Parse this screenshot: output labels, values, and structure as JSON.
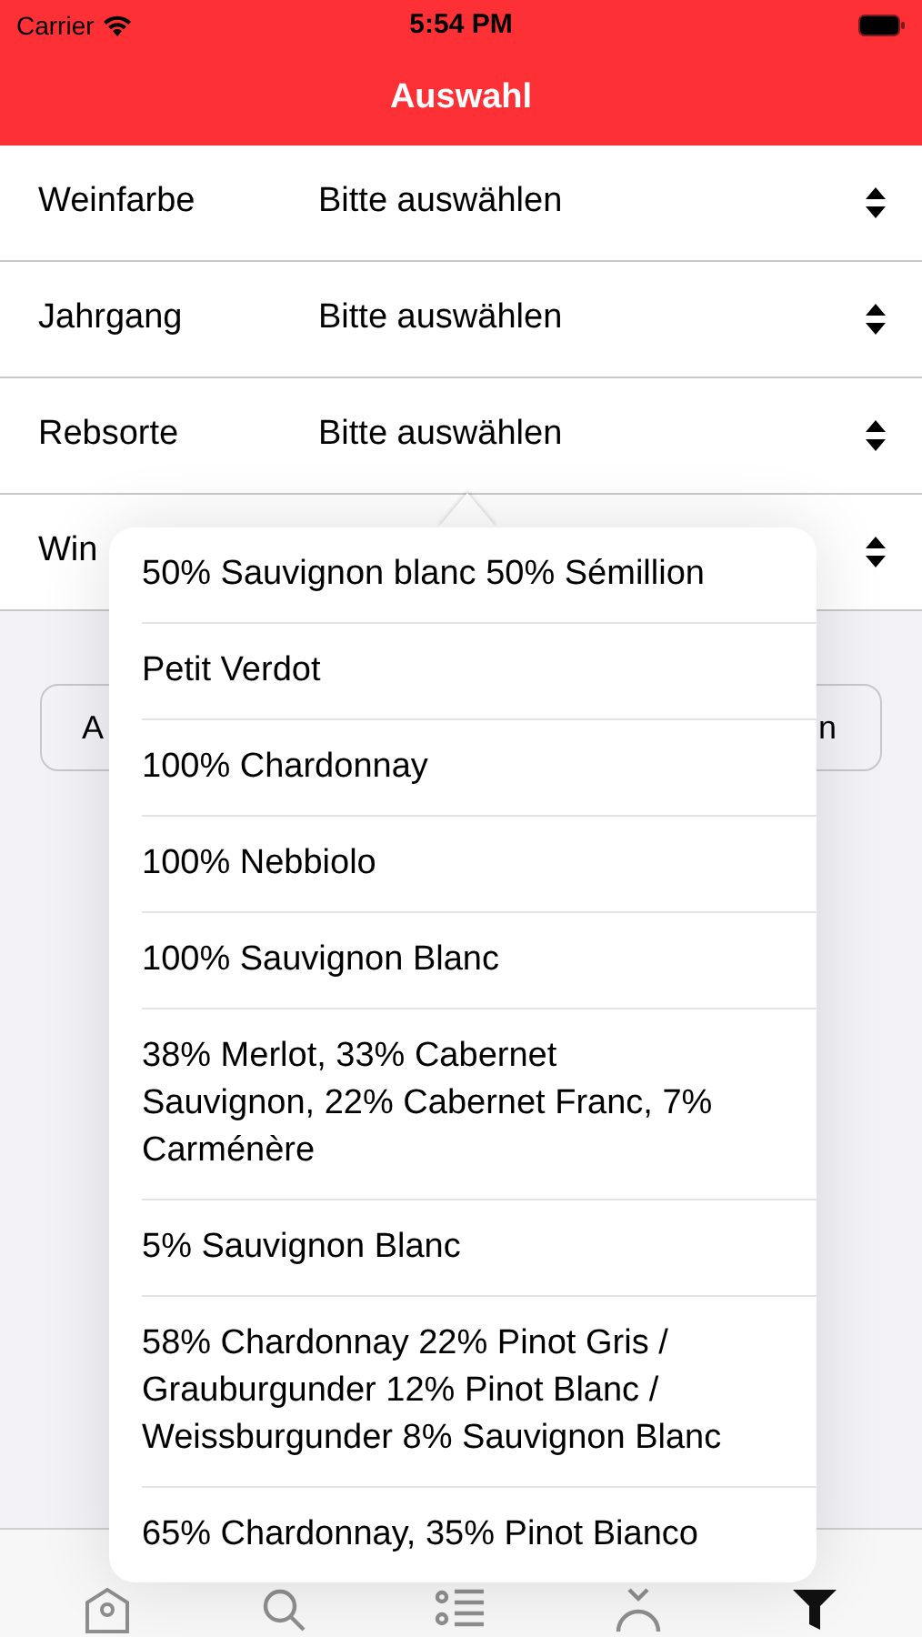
{
  "status_bar": {
    "carrier": "Carrier",
    "time": "5:54 PM"
  },
  "nav": {
    "title": "Auswahl"
  },
  "rows": [
    {
      "label": "Weinfarbe",
      "value": "Bitte auswählen"
    },
    {
      "label": "Jahrgang",
      "value": "Bitte auswählen"
    },
    {
      "label": "Rebsorte",
      "value": "Bitte auswählen"
    },
    {
      "label": "Win"
    }
  ],
  "buttons": [
    {
      "label": "A"
    },
    {
      "label": "n"
    }
  ],
  "popover": {
    "items": [
      "50% Sauvignon blanc 50% Sémillion",
      "Petit Verdot",
      "100% Chardonnay",
      "100% Nebbiolo",
      "100% Sauvignon Blanc",
      "38% Merlot, 33% Cabernet Sauvignon, 22% Cabernet Franc, 7% Carménère",
      "5% Sauvignon Blanc",
      "58% Chardonnay 22% Pinot Gris / Grauburgunder 12% Pinot Blanc / Weissburgunder 8% Sauvignon Blanc",
      "65% Chardonnay, 35% Pinot Bianco"
    ]
  },
  "tab_bar": [
    {
      "kind": "home",
      "selected": false
    },
    {
      "kind": "search",
      "selected": false
    },
    {
      "kind": "list",
      "selected": false
    },
    {
      "kind": "person",
      "selected": false
    },
    {
      "kind": "filter",
      "selected": true
    }
  ]
}
